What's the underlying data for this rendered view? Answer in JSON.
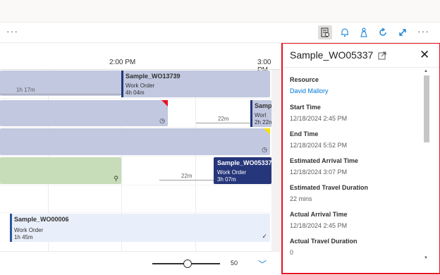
{
  "toolbar": {
    "more_left": "···",
    "more_right": "···",
    "icons": [
      "details-icon",
      "bell-icon",
      "flask-icon",
      "refresh-icon",
      "expand-icon"
    ]
  },
  "board": {
    "times": [
      "2:00 PM",
      "3:00 PM"
    ],
    "rows": [
      {
        "travel": "1h 17m",
        "title": "Sample_WO13739",
        "type": "Work Order",
        "duration": "4h 04m"
      },
      {
        "travel": "22m",
        "title": "Samp",
        "type": "Worl",
        "duration": "2h 22m"
      },
      {
        "travel": "22m",
        "title": "Sample_WO05337",
        "type": "Work Order",
        "duration": "3h 07m"
      },
      {
        "title": "Sample_WO00006",
        "type": "Work Order",
        "duration": "1h 45m"
      }
    ],
    "zoom": "50",
    "zoom_fraction": 0.52
  },
  "panel": {
    "title": "Sample_WO05337",
    "fields": [
      {
        "label": "Resource",
        "value": "David Mallory",
        "link": true
      },
      {
        "label": "Start Time",
        "value": "12/18/2024 2:45 PM"
      },
      {
        "label": "End Time",
        "value": "12/18/2024 5:52 PM"
      },
      {
        "label": "Estimated Arrival Time",
        "value": "12/18/2024 3:07 PM"
      },
      {
        "label": "Estimated Travel Duration",
        "value": "22 mins"
      },
      {
        "label": "Actual Arrival Time",
        "value": "12/18/2024 2:45 PM"
      },
      {
        "label": "Actual Travel Duration",
        "value": "0"
      }
    ]
  },
  "colors": {
    "accent": "#0078d4",
    "booking_dark": "#26367a",
    "booking_blue": "#c1c8e0",
    "highlight_border": "#e81123"
  }
}
